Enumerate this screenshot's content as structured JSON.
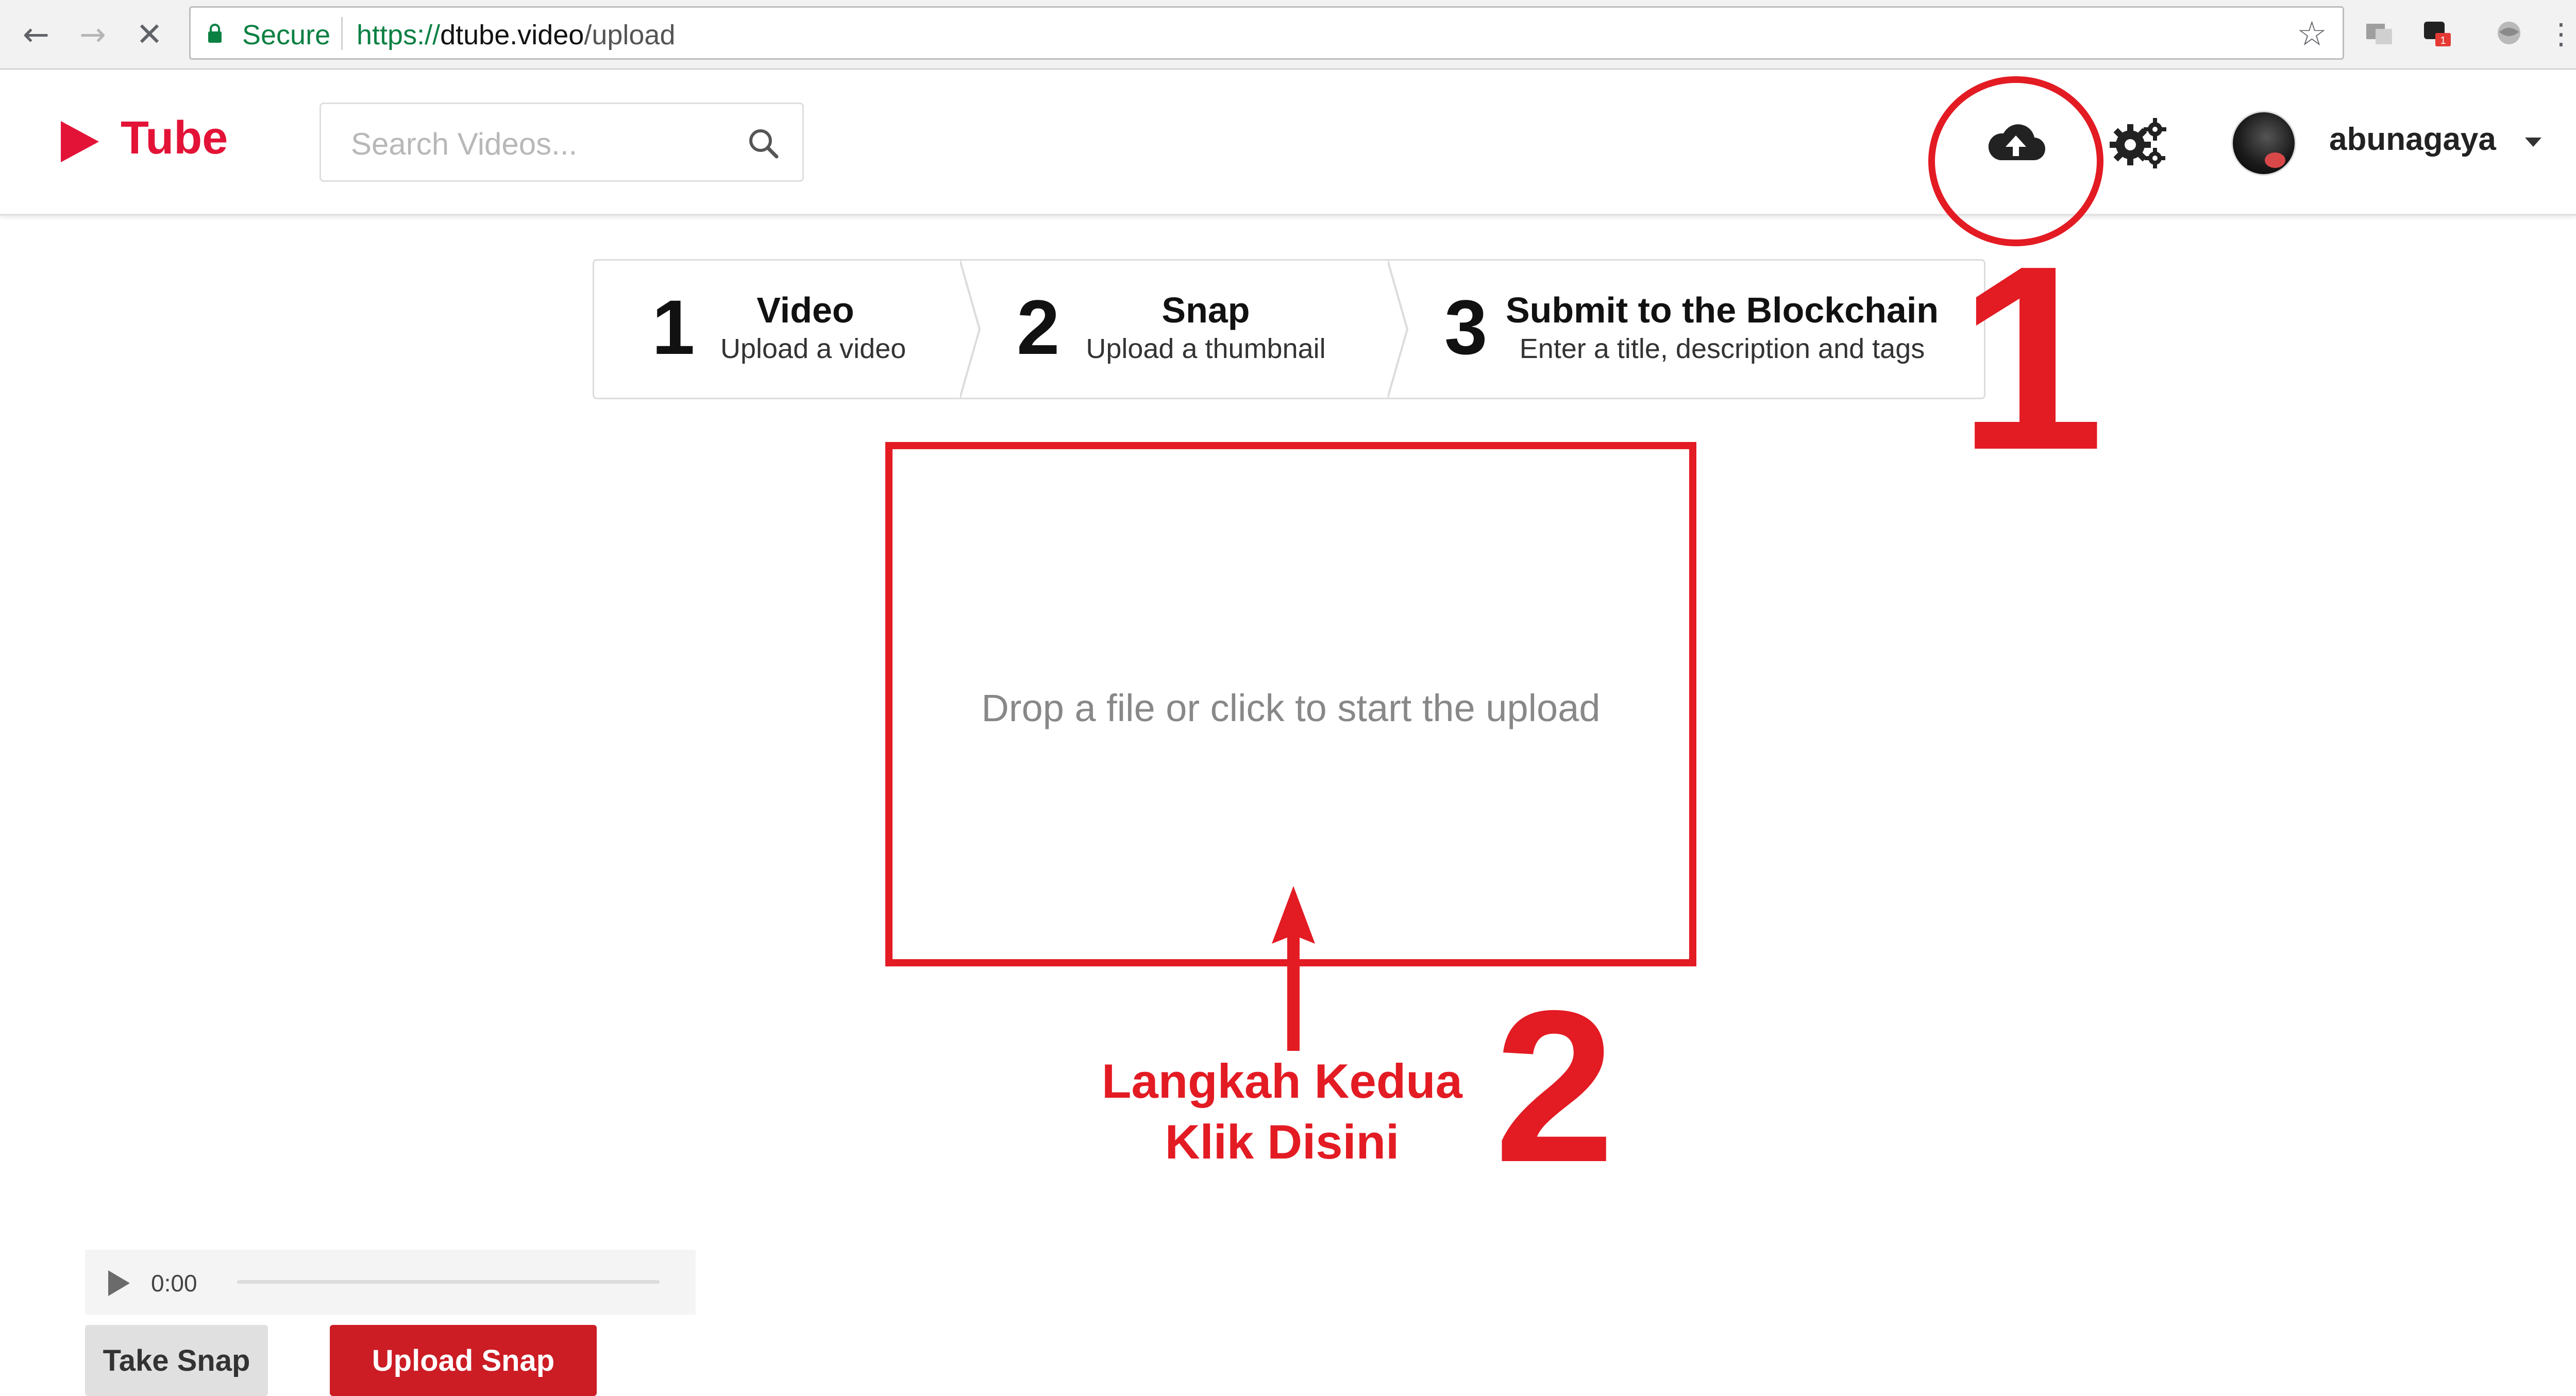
{
  "browser": {
    "secure_label": "Secure",
    "url_scheme": "https://",
    "url_host": "dtube.video",
    "url_path": "/upload",
    "extension_badge": "1"
  },
  "header": {
    "logo_text": "Tube",
    "search_placeholder": "Search Videos...",
    "username": "abunagaya"
  },
  "steps": [
    {
      "number": "1",
      "title": "Video",
      "description": "Upload a video"
    },
    {
      "number": "2",
      "title": "Snap",
      "description": "Upload a thumbnail"
    },
    {
      "number": "3",
      "title": "Submit to the Blockchain",
      "description": "Enter a title, description and tags"
    }
  ],
  "dropzone": {
    "text": "Drop a file or click to start the upload"
  },
  "annotations": {
    "marker_one": "1",
    "marker_two": "2",
    "note_line1": "Langkah Kedua",
    "note_line2": "Klik Disini",
    "color": "#e31b23"
  },
  "player": {
    "time": "0:00"
  },
  "buttons": {
    "take_snap": "Take Snap",
    "upload_snap": "Upload Snap"
  },
  "colors": {
    "brand": "#e31337",
    "secure": "#0b8043",
    "upload_snap_bg": "#cc1c24"
  }
}
